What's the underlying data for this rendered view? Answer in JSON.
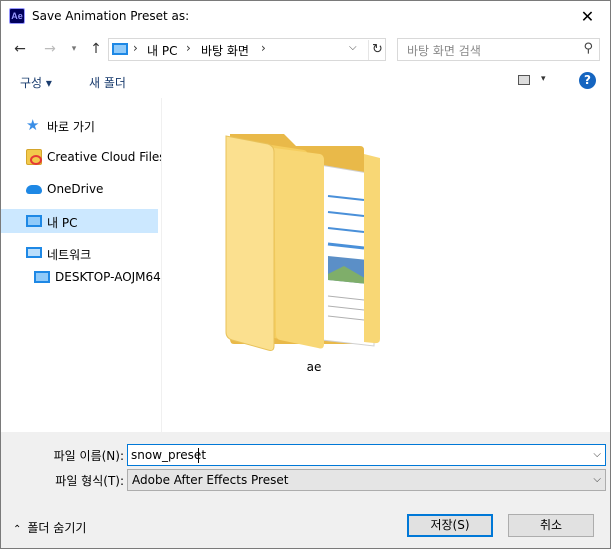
{
  "window": {
    "title": "Save Animation Preset as:",
    "app_icon": "Ae",
    "close_glyph": "✕"
  },
  "nav": {
    "back_glyph": "←",
    "forward_glyph": "→",
    "recent_glyph": "▾",
    "up_glyph": "↑",
    "address": {
      "crumbs": [
        "내 PC",
        "바탕 화면"
      ],
      "separator": "›",
      "dropdown_glyph": "⌵",
      "refresh_glyph": "↻"
    },
    "search": {
      "placeholder": "바탕 화면 검색",
      "icon_glyph": "⚲"
    }
  },
  "toolbar": {
    "organize_label": "구성 ▾",
    "new_folder_label": "새 폴더",
    "view_drop_glyph": "▾",
    "help_glyph": "?"
  },
  "sidebar": {
    "items": [
      {
        "label": "바로 가기",
        "icon": "star-icon"
      },
      {
        "label": "Creative Cloud Files",
        "icon": "creative-cloud-folder-icon"
      },
      {
        "label": "OneDrive",
        "icon": "cloud-icon"
      },
      {
        "label": "내 PC",
        "icon": "computer-icon",
        "selected": true
      },
      {
        "label": "네트워크",
        "icon": "network-icon"
      },
      {
        "label": "DESKTOP-AOJM64",
        "icon": "computer-icon"
      }
    ]
  },
  "content": {
    "items": [
      {
        "name": "ae",
        "icon": "folder-icon"
      }
    ]
  },
  "bottom": {
    "file_name_label": "파일 이름(N):",
    "file_name_value": "snow_preset",
    "file_type_label": "파일 형식(T):",
    "file_type_value": "Adobe After Effects Preset",
    "dropdown_glyph": "⌵",
    "hide_folders_label": "폴더 숨기기",
    "hide_folders_glyph": "⌃",
    "save_label": "저장(S)",
    "cancel_label": "취소"
  },
  "colors": {
    "accent": "#0078d7",
    "selected_bg": "#cce8ff",
    "bottom_bg": "#f0f0f0",
    "folder_yellow": "#f8d775"
  }
}
